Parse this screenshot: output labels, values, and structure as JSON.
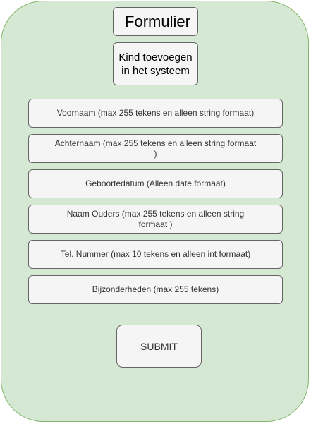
{
  "form": {
    "title": "Formulier",
    "subtitle": "Kind toevoegen in het systeem",
    "fields": [
      "Voornaam (max 255 tekens en alleen string formaat)",
      "Achternaam (max 255 tekens en alleen string formaat )",
      "Geboortedatum (Alleen date formaat)",
      "Naam Ouders (max 255 tekens en alleen string formaat )",
      "Tel. Nummer (max 10 tekens en alleen int formaat)",
      "Bijzonderheden (max 255 tekens)"
    ],
    "submit_label": "SUBMIT"
  },
  "colors": {
    "frame_fill": "#d5e8d4",
    "frame_stroke": "#82b366",
    "box_fill": "#f5f5f5",
    "box_stroke": "#666666"
  }
}
